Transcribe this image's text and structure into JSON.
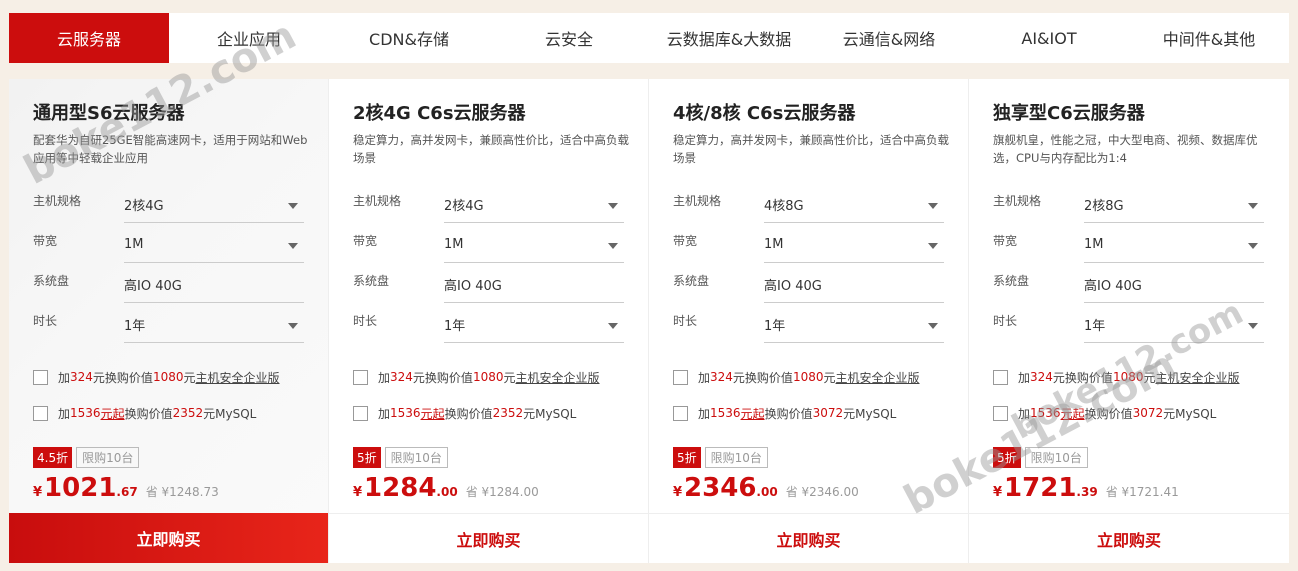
{
  "tabs": [
    "云服务器",
    "企业应用",
    "CDN&存储",
    "云安全",
    "云数据库&大数据",
    "云通信&网络",
    "AI&IOT",
    "中间件&其他"
  ],
  "spec_labels": {
    "host": "主机规格",
    "bandwidth": "带宽",
    "disk": "系统盘",
    "duration": "时长"
  },
  "limit_label": "限购10台",
  "buy_label": "立即购买",
  "currency": "¥",
  "save_prefix": "省",
  "opt1": {
    "pre": "加",
    "amt": "324",
    "mid1": "元换购价值",
    "val": "1080",
    "mid2": "元",
    "tail": "主机安全企业版"
  },
  "opt2": {
    "pre": "加",
    "amt": "1536",
    "mid1": "元起",
    "mid2": "换购价值",
    "mid3": "元MySQL"
  },
  "cards": [
    {
      "title": "通用型S6云服务器",
      "desc": "配套华为自研25GE智能高速网卡，适用于网站和Web应用等中轻载企业应用",
      "host": "2核4G",
      "bandwidth": "1M",
      "disk": "高IO 40G",
      "duration": "1年",
      "mysql_val": "2352",
      "discount": "4.5折",
      "price_int": "1021",
      "price_dec": ".67",
      "orig": "省 ¥1248.73"
    },
    {
      "title": "2核4G C6s云服务器",
      "desc": "稳定算力，高并发网卡，兼顾高性价比，适合中高负载场景",
      "host": "2核4G",
      "bandwidth": "1M",
      "disk": "高IO 40G",
      "duration": "1年",
      "mysql_val": "2352",
      "discount": "5折",
      "price_int": "1284",
      "price_dec": ".00",
      "orig": "省 ¥1284.00"
    },
    {
      "title": "4核/8核 C6s云服务器",
      "desc": "稳定算力，高并发网卡，兼顾高性价比，适合中高负载场景",
      "host": "4核8G",
      "bandwidth": "1M",
      "disk": "高IO 40G",
      "duration": "1年",
      "mysql_val": "3072",
      "discount": "5折",
      "price_int": "2346",
      "price_dec": ".00",
      "orig": "省 ¥2346.00"
    },
    {
      "title": "独享型C6云服务器",
      "desc": "旗舰机皇，性能之冠，中大型电商、视频、数据库优选，CPU与内存配比为1:4",
      "host": "2核8G",
      "bandwidth": "1M",
      "disk": "高IO 40G",
      "duration": "1年",
      "mysql_val": "3072",
      "discount": "5折",
      "price_int": "1721",
      "price_dec": ".39",
      "orig": "省 ¥1721.41"
    }
  ],
  "watermark": "boke112.com",
  "colors": {
    "accent": "#cc0d0d",
    "background": "#f6efe6"
  }
}
